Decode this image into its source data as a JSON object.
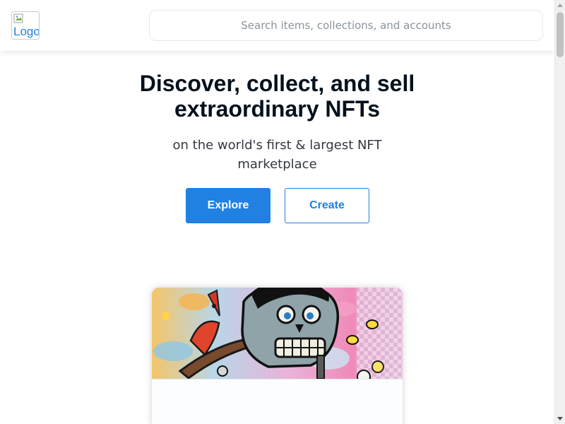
{
  "header": {
    "logo_alt": "Logo",
    "search_placeholder": "Search items, collections, and accounts"
  },
  "hero": {
    "title": "Discover, collect, and sell extraordinary NFTs",
    "subtitle": "on the world's first & largest NFT marketplace",
    "explore_label": "Explore",
    "create_label": "Create"
  },
  "colors": {
    "accent": "#2081e2",
    "heading": "#04111d",
    "body_text": "#353840",
    "placeholder": "#8a939b",
    "border": "#e5e8eb"
  },
  "icons": {
    "logo": "broken-image-icon",
    "scroll_up": "scroll-up-arrow-icon",
    "scroll_down": "scroll-down-arrow-icon"
  },
  "featured": {
    "art": "cartoon-skull-artwork"
  }
}
